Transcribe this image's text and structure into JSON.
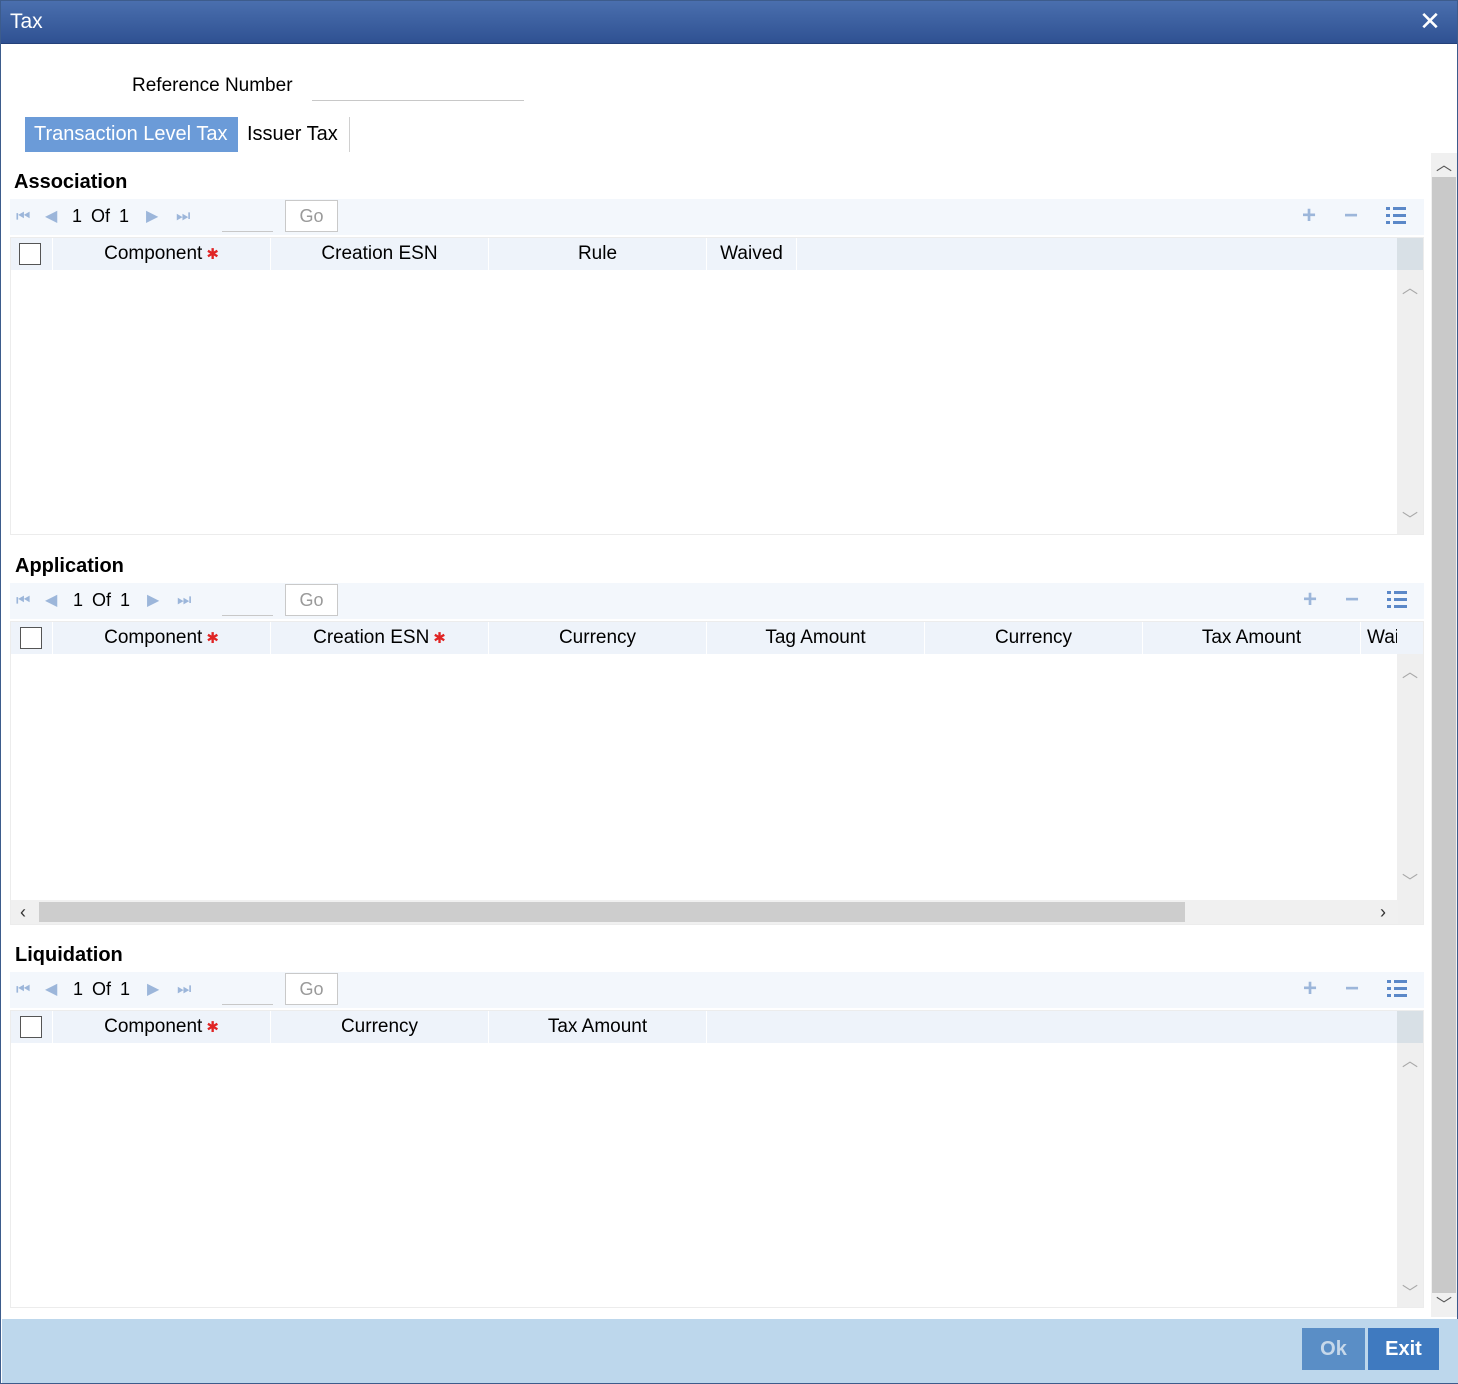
{
  "window": {
    "title": "Tax",
    "close_icon": "close-icon"
  },
  "reference": {
    "label": "Reference Number",
    "value": ""
  },
  "tabs": [
    {
      "label": "Transaction Level Tax",
      "active": true
    },
    {
      "label": "Issuer Tax",
      "active": false
    }
  ],
  "association": {
    "title": "Association",
    "pager": {
      "current": "1",
      "of": "Of",
      "total": "1",
      "go": "Go"
    },
    "columns": [
      {
        "label": "Component",
        "required": true
      },
      {
        "label": "Creation ESN",
        "required": false
      },
      {
        "label": "Rule",
        "required": false
      },
      {
        "label": "Waived",
        "required": false
      }
    ],
    "rows": []
  },
  "application": {
    "title": "Application",
    "pager": {
      "current": "1",
      "of": "Of",
      "total": "1",
      "go": "Go"
    },
    "columns": [
      {
        "label": "Component",
        "required": true
      },
      {
        "label": "Creation ESN",
        "required": true
      },
      {
        "label": "Currency",
        "required": false
      },
      {
        "label": "Tag Amount",
        "required": false
      },
      {
        "label": "Currency",
        "required": false
      },
      {
        "label": "Tax Amount",
        "required": false
      },
      {
        "label": "Wai",
        "required": false
      }
    ],
    "rows": []
  },
  "liquidation": {
    "title": "Liquidation",
    "pager": {
      "current": "1",
      "of": "Of",
      "total": "1",
      "go": "Go"
    },
    "columns": [
      {
        "label": "Component",
        "required": true
      },
      {
        "label": "Currency",
        "required": false
      },
      {
        "label": "Tax Amount",
        "required": false
      }
    ],
    "rows": []
  },
  "footer": {
    "ok_label": "Ok",
    "exit_label": "Exit"
  },
  "colors": {
    "title_bar": "#2f5192",
    "active_tab": "#6b9bd8",
    "footer": "#bdd7ec",
    "required": "#e02424"
  }
}
